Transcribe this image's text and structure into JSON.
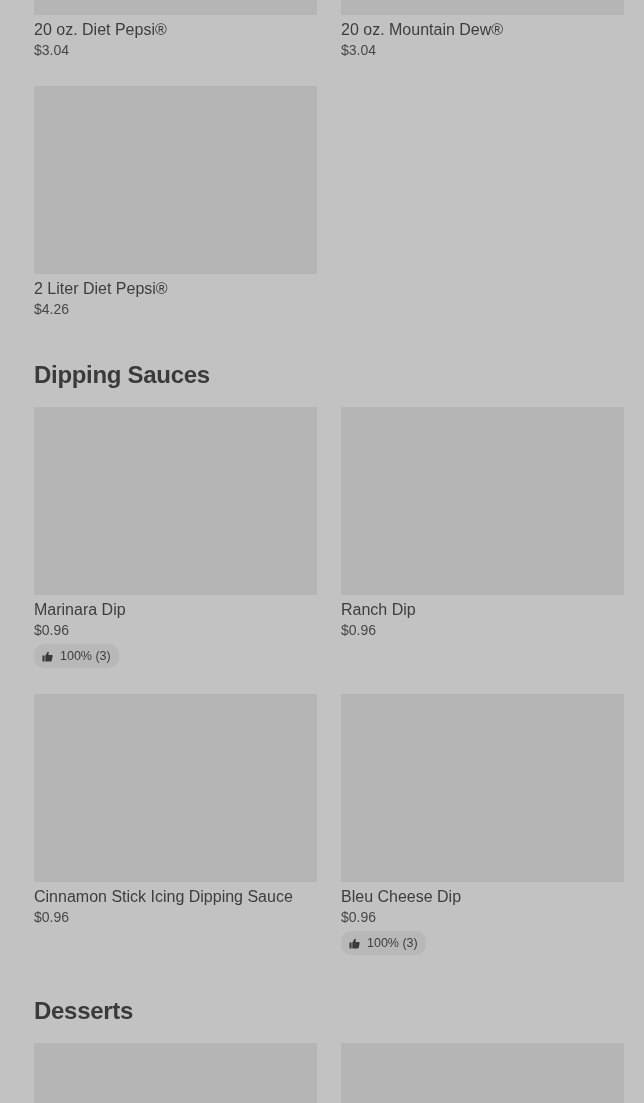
{
  "sections": [
    {
      "items": [
        {
          "kind": "product",
          "name": "20 oz. Diet Pepsi®",
          "price": "$3.04"
        },
        {
          "kind": "product",
          "name": "20 oz. Mountain Dew®",
          "price": "$3.04"
        },
        {
          "kind": "product",
          "name": "2 Liter Diet Pepsi®",
          "price": "$4.26"
        }
      ]
    },
    {
      "title": "Dipping Sauces",
      "items": [
        {
          "kind": "product",
          "name": "Marinara Dip",
          "price": "$0.96",
          "rating": "100% (3)"
        },
        {
          "kind": "product",
          "name": "Ranch Dip",
          "price": "$0.96"
        },
        {
          "kind": "product",
          "name": "Cinnamon Stick Icing Dipping Sauce",
          "price": "$0.96"
        },
        {
          "kind": "product",
          "name": "Bleu Cheese Dip",
          "price": "$0.96",
          "rating": "100% (3)"
        }
      ]
    },
    {
      "title": "Desserts"
    }
  ]
}
